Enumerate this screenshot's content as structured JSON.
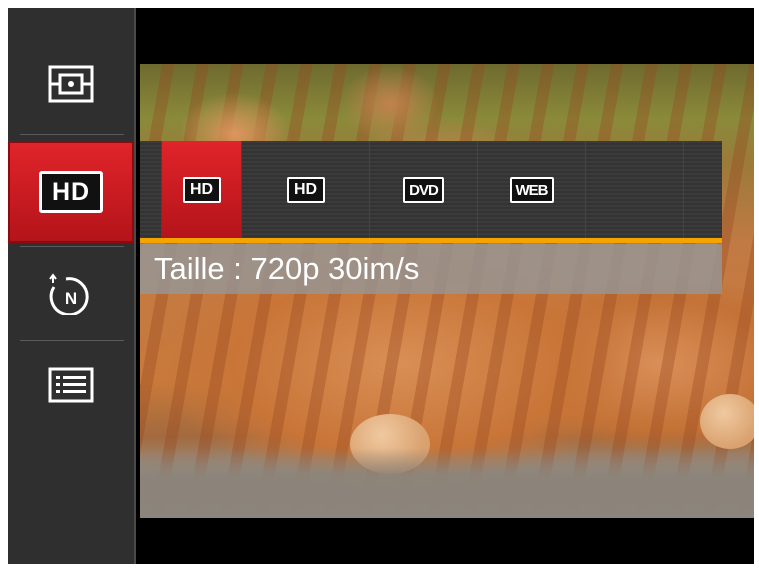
{
  "sidebar": {
    "items": [
      {
        "icon": "metering-icon"
      },
      {
        "icon": "hd-icon",
        "label": "HD",
        "active": true
      },
      {
        "icon": "scene-n-icon",
        "label": "N"
      },
      {
        "icon": "menu-list-icon"
      }
    ]
  },
  "options": [
    {
      "label": "HD",
      "selected": true
    },
    {
      "label": "HD",
      "selected": false
    },
    {
      "label": "DVD",
      "selected": false
    },
    {
      "label": "WEB",
      "selected": false
    }
  ],
  "caption": "Taille : 720p 30im/s",
  "colors": {
    "accent_red": "#d41c22",
    "highlight_bar": "#f5a300",
    "panel": "#2f2f2f"
  }
}
